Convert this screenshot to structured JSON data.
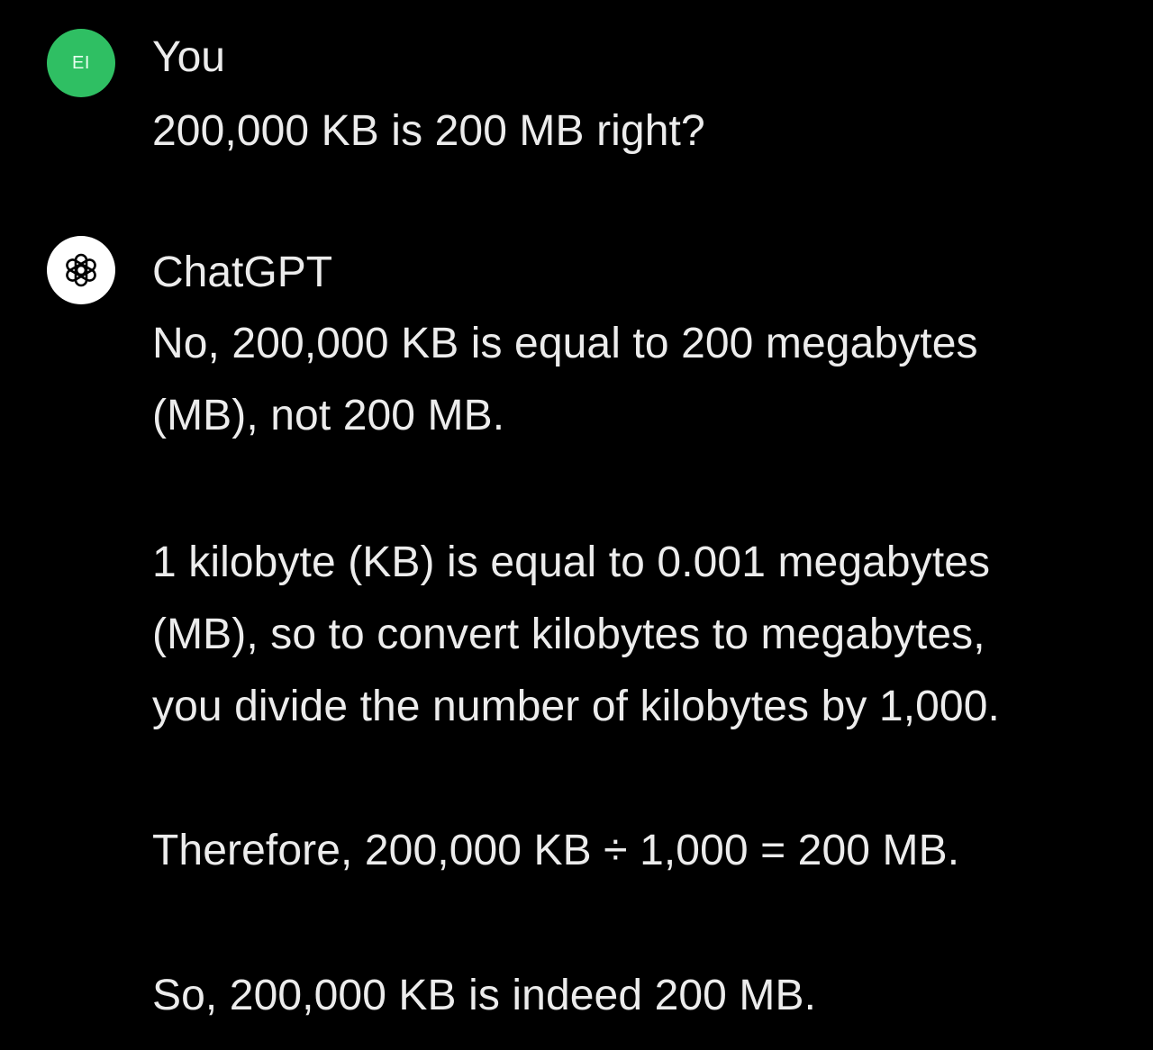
{
  "conversation": {
    "user": {
      "avatar_initials": "EI",
      "avatar_color": "#2fbf63",
      "name": "You",
      "message": "200,000 KB is 200 MB right?"
    },
    "assistant": {
      "avatar_icon": "openai-logo-icon",
      "name": "ChatGPT",
      "paragraphs": [
        {
          "lines": [
            "No, 200,000 KB is equal to 200 megabytes",
            "(MB), not 200 MB."
          ]
        },
        {
          "lines": [
            "1 kilobyte (KB) is equal to 0.001 megabytes",
            "(MB), so to convert kilobytes to megabytes,",
            "you divide the number of kilobytes by 1,000."
          ]
        },
        {
          "lines": [
            "Therefore, 200,000 KB ÷ 1,000 = 200 MB."
          ]
        },
        {
          "lines": [
            "So, 200,000 KB is indeed 200 MB."
          ]
        }
      ]
    }
  },
  "colors": {
    "background": "#000000",
    "text": "#ececec"
  }
}
